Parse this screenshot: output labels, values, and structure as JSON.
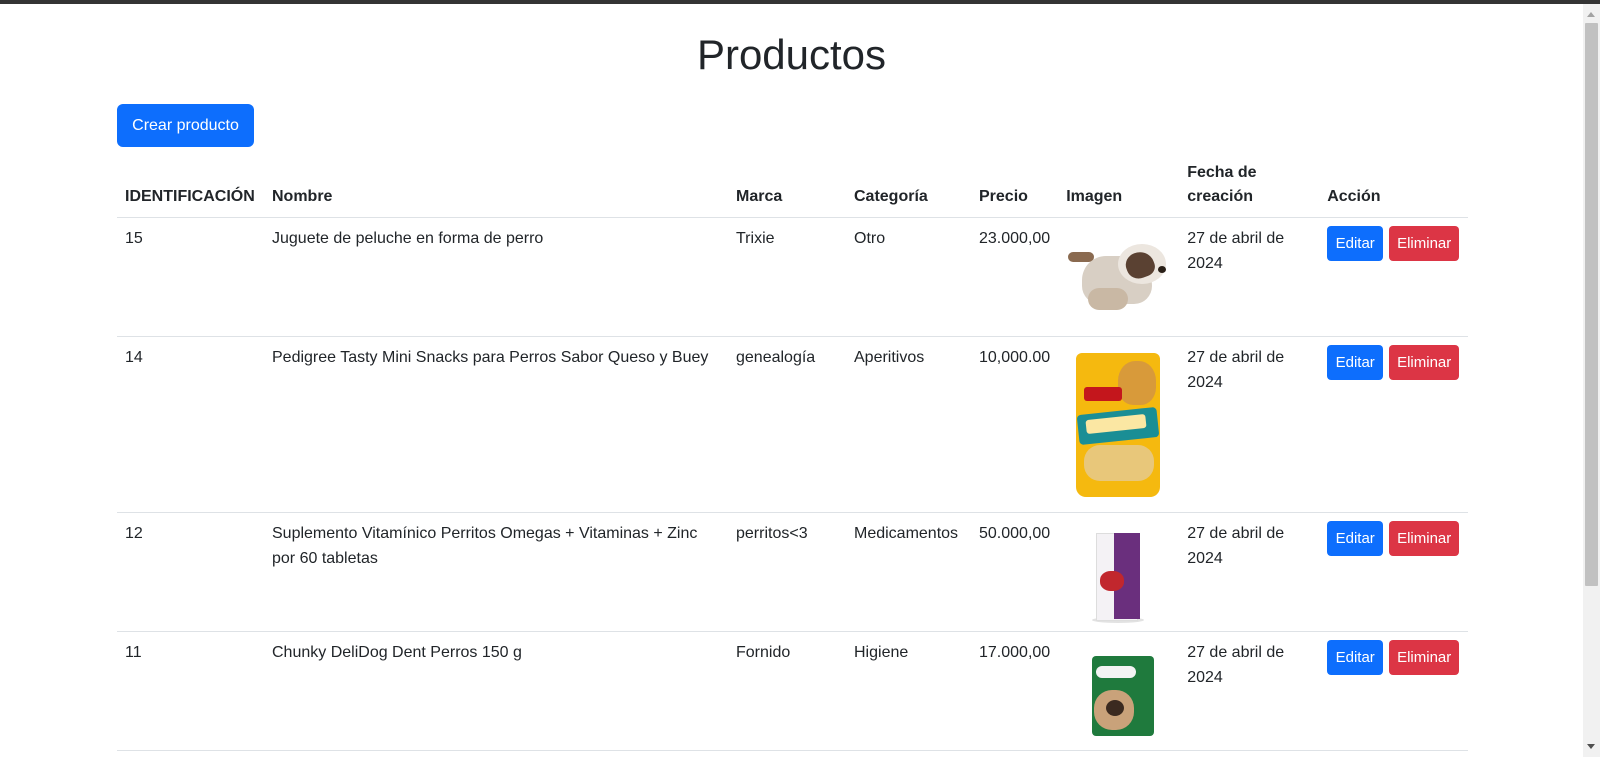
{
  "page": {
    "title": "Productos"
  },
  "toolbar": {
    "create_label": "Crear producto"
  },
  "table": {
    "headers": {
      "id": "IDENTIFICACIÓN",
      "name": "Nombre",
      "brand": "Marca",
      "category": "Categoría",
      "price": "Precio",
      "image": "Imagen",
      "date": "Fecha de creación",
      "action": "Acción"
    },
    "rows": [
      {
        "id": "15",
        "name": "Juguete de peluche en forma de perro",
        "brand": "Trixie",
        "category": "Otro",
        "price": "23.000,00",
        "image_icon": "plush-dog-toy-image",
        "date": "27 de abril de 2024",
        "edit_label": "Editar",
        "delete_label": "Eliminar"
      },
      {
        "id": "14",
        "name": "Pedigree Tasty Mini Snacks para Perros Sabor Queso y Buey",
        "brand": "genealogía",
        "category": "Aperitivos",
        "price": "10,000.00",
        "image_icon": "pedigree-tasty-bites-bag-image",
        "date": "27 de abril de 2024",
        "edit_label": "Editar",
        "delete_label": "Eliminar"
      },
      {
        "id": "12",
        "name": "Suplemento Vitamínico Perritos Omegas + Vitaminas + Zinc por 60 tabletas",
        "brand": "perritos<3",
        "category": "Medicamentos",
        "price": "50.000,00",
        "image_icon": "supplement-box-image",
        "date": "27 de abril de 2024",
        "edit_label": "Editar",
        "delete_label": "Eliminar"
      },
      {
        "id": "11",
        "name": "Chunky DeliDog Dent Perros 150 g",
        "brand": "Fornido",
        "category": "Higiene",
        "price": "17.000,00",
        "image_icon": "chunky-delidog-pouch-image",
        "date": "27 de abril de 2024",
        "edit_label": "Editar",
        "delete_label": "Eliminar"
      }
    ]
  },
  "colors": {
    "primary": "#0d6efd",
    "danger": "#dc3545",
    "text": "#212529",
    "border": "#dee2e6"
  }
}
